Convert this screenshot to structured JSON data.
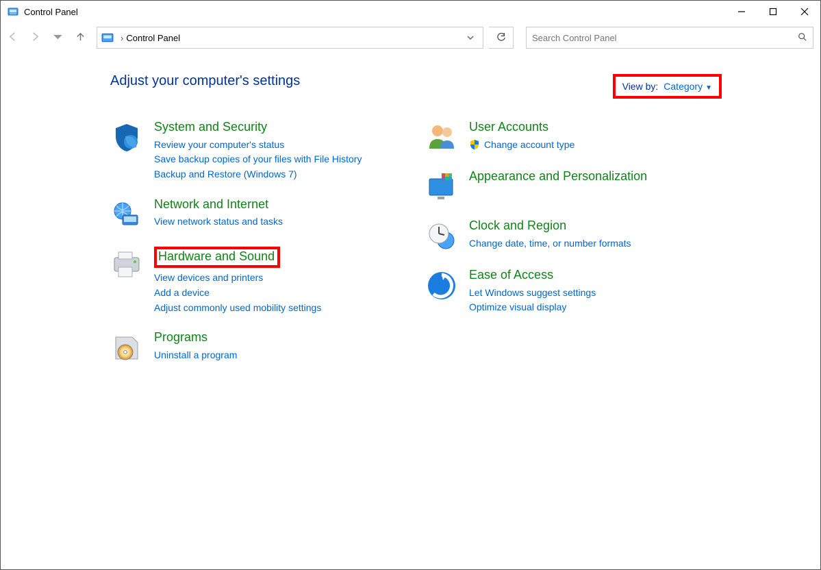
{
  "window": {
    "title": "Control Panel"
  },
  "toolbar": {
    "breadcrumb": "Control Panel",
    "search_placeholder": "Search Control Panel"
  },
  "headline": "Adjust your computer's settings",
  "viewby": {
    "label": "View by:",
    "value": "Category"
  },
  "categories": {
    "system": {
      "title": "System and Security",
      "tasks": [
        "Review your computer's status",
        "Save backup copies of your files with File History",
        "Backup and Restore (Windows 7)"
      ]
    },
    "network": {
      "title": "Network and Internet",
      "tasks": [
        "View network status and tasks"
      ]
    },
    "hardware": {
      "title": "Hardware and Sound",
      "tasks": [
        "View devices and printers",
        "Add a device",
        "Adjust commonly used mobility settings"
      ]
    },
    "programs": {
      "title": "Programs",
      "tasks": [
        "Uninstall a program"
      ]
    },
    "user": {
      "title": "User Accounts",
      "tasks": [
        "Change account type"
      ]
    },
    "appearance": {
      "title": "Appearance and Personalization",
      "tasks": []
    },
    "clock": {
      "title": "Clock and Region",
      "tasks": [
        "Change date, time, or number formats"
      ]
    },
    "ease": {
      "title": "Ease of Access",
      "tasks": [
        "Let Windows suggest settings",
        "Optimize visual display"
      ]
    }
  },
  "highlights": {
    "viewby_boxed": true,
    "hardware_title_boxed": true
  }
}
